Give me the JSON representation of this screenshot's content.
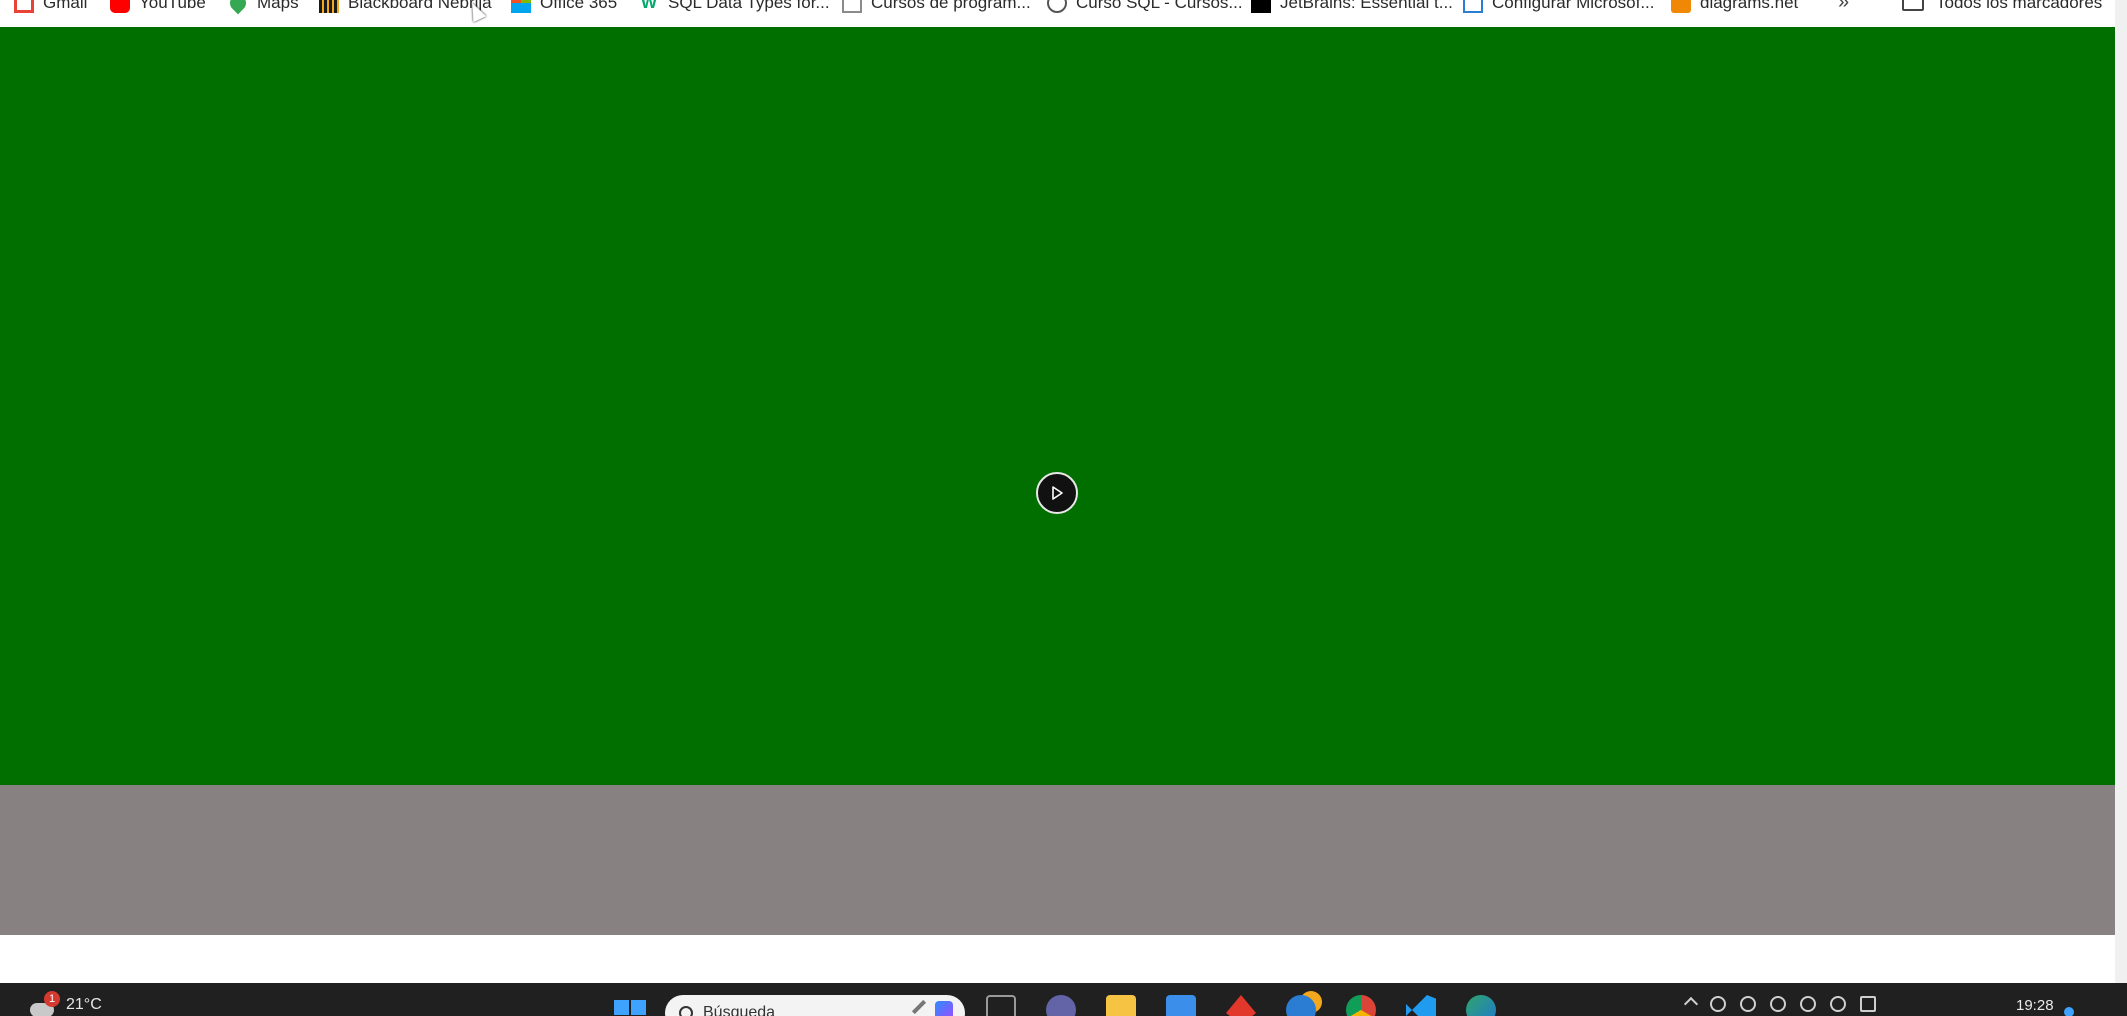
{
  "bookmarks": [
    {
      "label": "Gmail",
      "icon": "gmail-icon",
      "color": "#ea4335"
    },
    {
      "label": "YouTube",
      "icon": "youtube-icon",
      "color": "#ff0000"
    },
    {
      "label": "Maps",
      "icon": "maps-icon",
      "color": "#34a853"
    },
    {
      "label": "Blackboard Nebrija",
      "icon": "blackboard-icon",
      "color": "#1a1a1a"
    },
    {
      "label": "Office 365",
      "icon": "office-icon",
      "color": "#f25022"
    },
    {
      "label": "SQL Data Types for...",
      "icon": "w3schools-icon",
      "color": "#04aa6d"
    },
    {
      "label": "Cursos de program...",
      "icon": "doc-icon",
      "color": "#8a8a8a"
    },
    {
      "label": "Curso SQL - Cursos...",
      "icon": "globe-icon",
      "color": "#555555"
    },
    {
      "label": "JetBrains: Essential t...",
      "icon": "jetbrains-icon",
      "color": "#000000"
    },
    {
      "label": "Configurar Microsof...",
      "icon": "page-icon",
      "color": "#2b7cd3"
    },
    {
      "label": "diagrams.net",
      "icon": "drawio-icon",
      "color": "#f08705"
    }
  ],
  "overflow_label": "»",
  "all_bookmarks_label": "Todos los marcadores",
  "video": {
    "background": "#006f00",
    "controls_background": "#878182"
  },
  "taskbar": {
    "weather_badge": "1",
    "temperature": "21°C",
    "search_placeholder": "Búsqueda",
    "time": "19:28",
    "apps": [
      {
        "icon": "task-view-icon",
        "color": "#9a9a9a"
      },
      {
        "icon": "teams-icon",
        "color": "#6264a7"
      },
      {
        "icon": "file-explorer-icon",
        "color": "#f6c343"
      },
      {
        "icon": "store-icon",
        "color": "#3b8eea"
      },
      {
        "icon": "app-red-icon",
        "color": "#e2372b"
      },
      {
        "icon": "chrome-canary-icon",
        "color": "#f2a81d"
      },
      {
        "icon": "chrome-icon",
        "color": "#db4437"
      },
      {
        "icon": "vscode-icon",
        "color": "#1f9cf0"
      },
      {
        "icon": "edge-icon",
        "color": "#2fa56b"
      }
    ]
  }
}
